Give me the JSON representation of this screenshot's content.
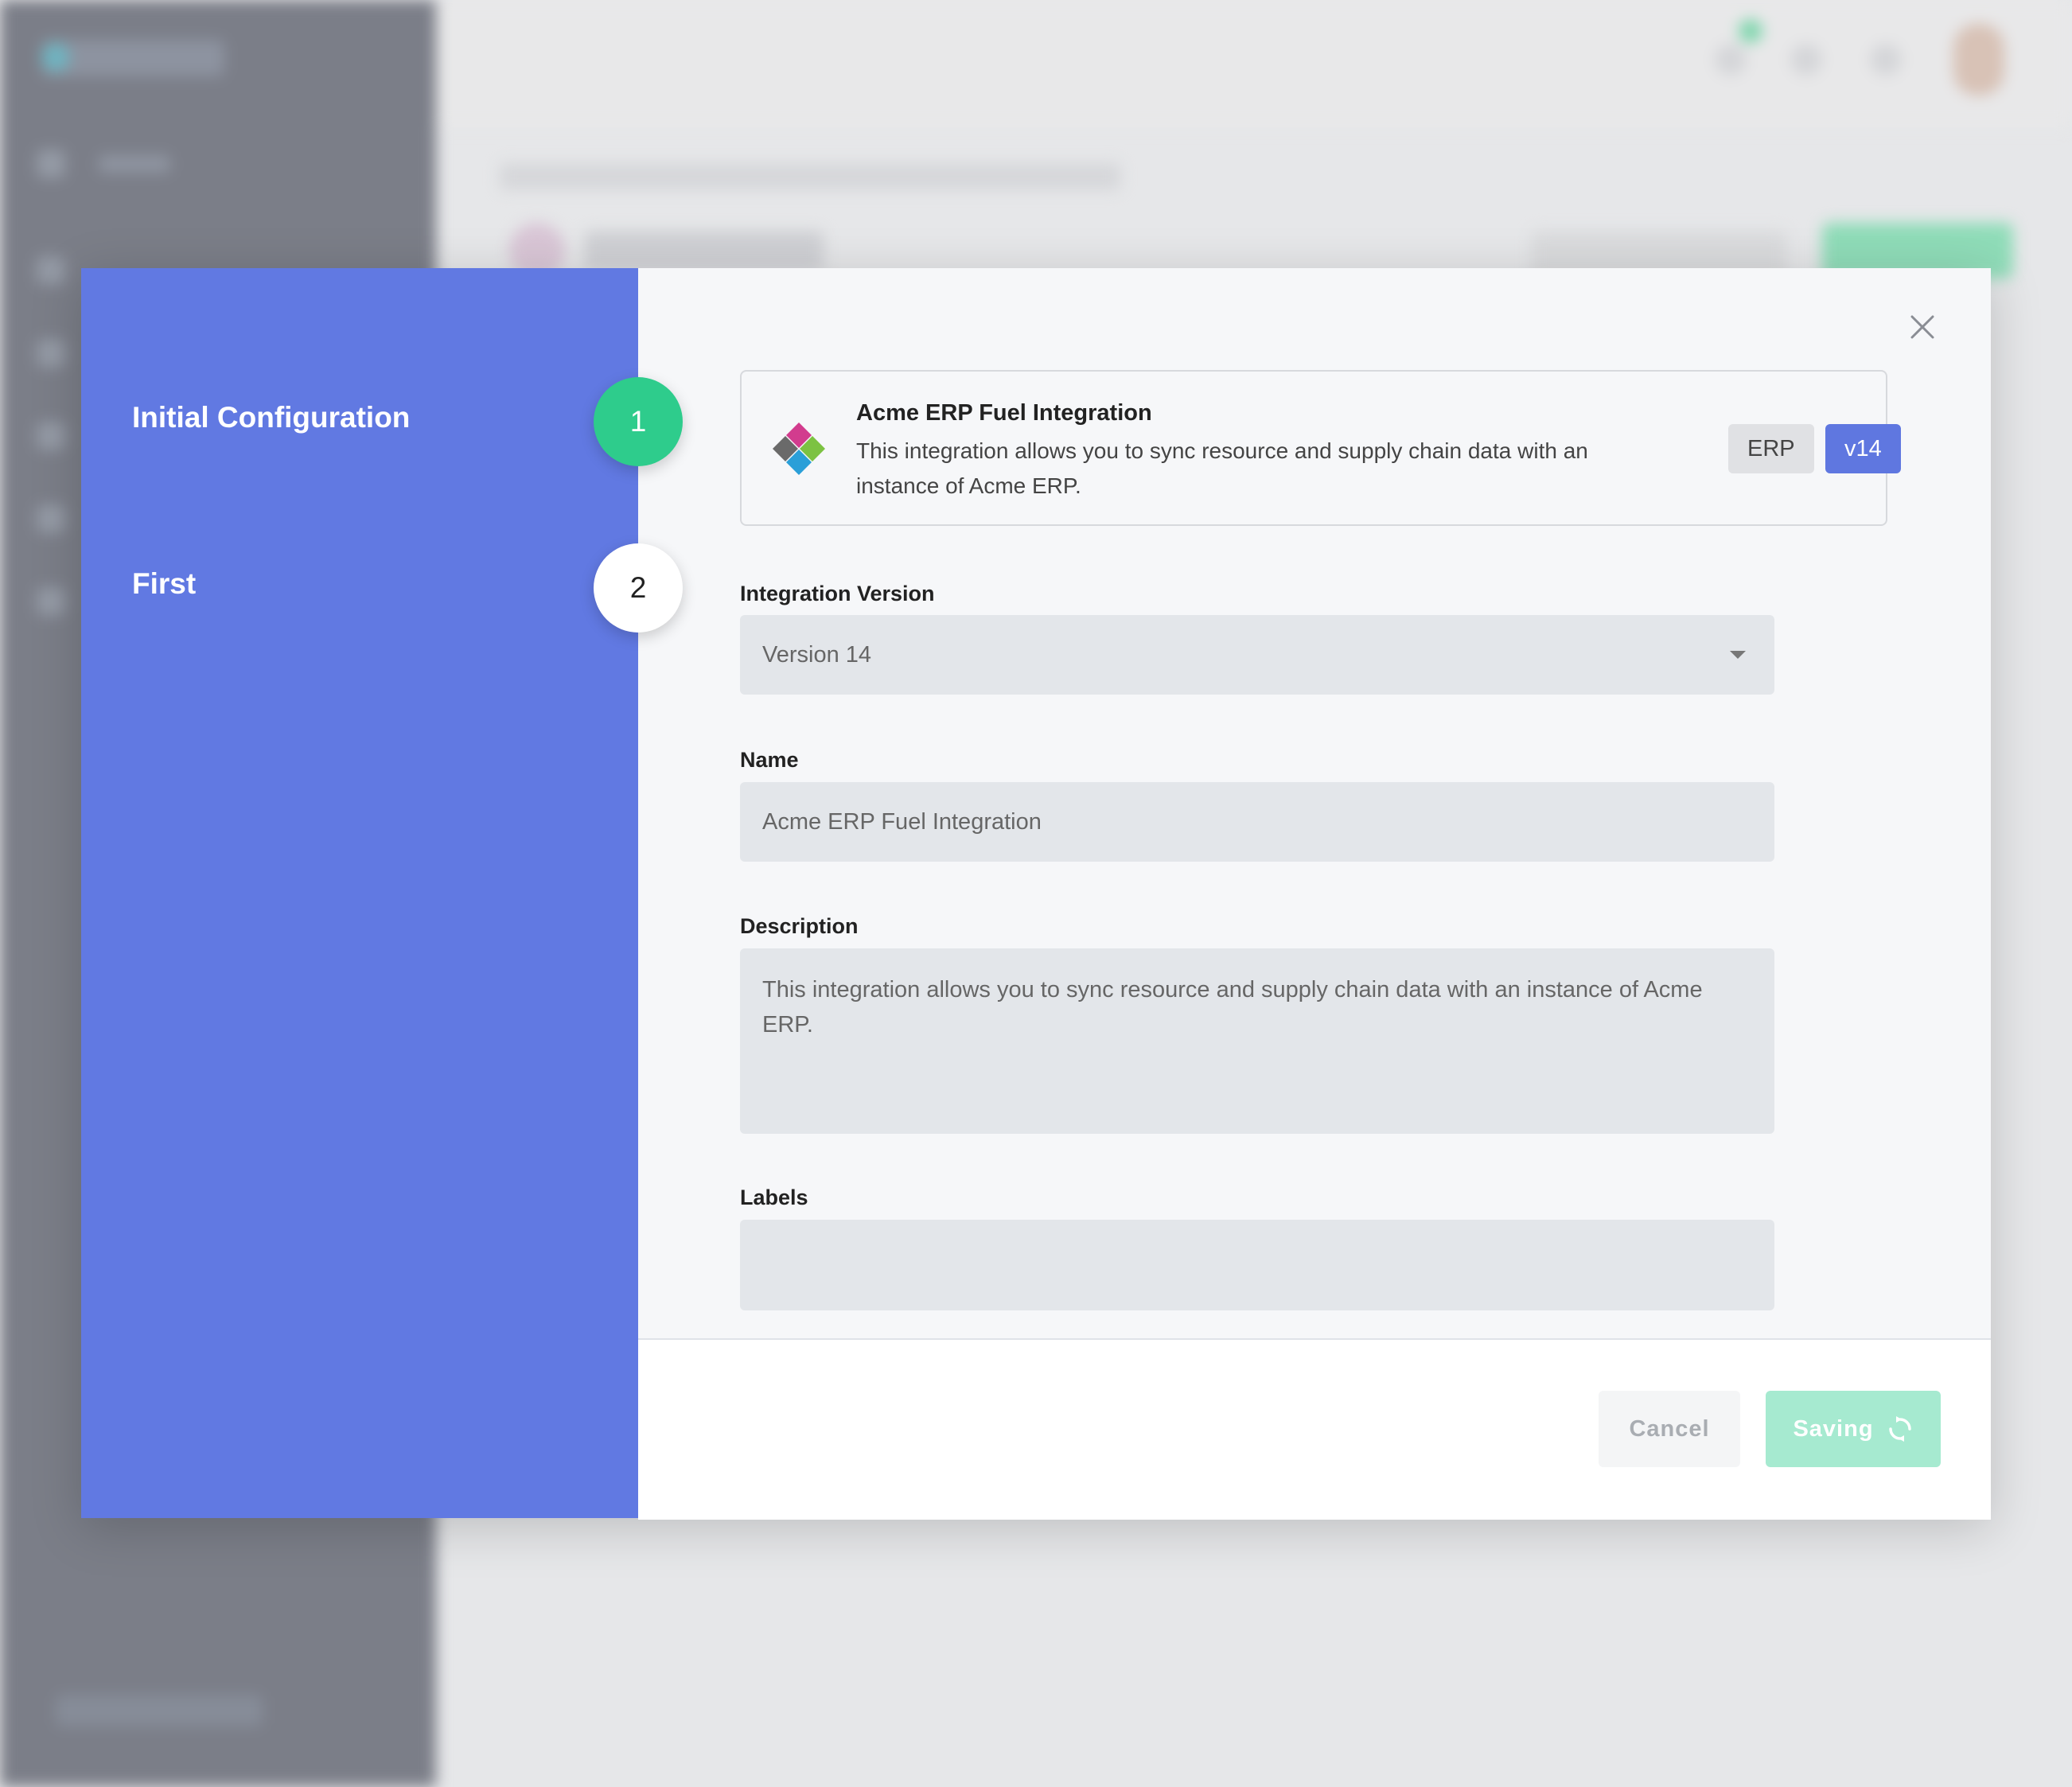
{
  "steps": [
    {
      "label": "Initial Configuration",
      "number": "1",
      "state": "active"
    },
    {
      "label": "First",
      "number": "2",
      "state": "inactive"
    }
  ],
  "card": {
    "title": "Acme ERP Fuel Integration",
    "description": "This integration allows you to sync resource and supply chain data with an instance of Acme ERP.",
    "tags": [
      "ERP",
      "v14"
    ],
    "logo_icon": "diamond-logo-icon"
  },
  "form": {
    "version_label": "Integration Version",
    "version_value": "Version 14",
    "name_label": "Name",
    "name_value": "Acme ERP Fuel Integration",
    "description_label": "Description",
    "description_value": "This integration allows you to sync resource and supply chain data with an instance of Acme ERP.",
    "labels_label": "Labels",
    "labels_value": ""
  },
  "footer": {
    "cancel_label": "Cancel",
    "save_label": "Saving"
  },
  "colors": {
    "sidebar_accent": "#6179e2",
    "active_step": "#2ecc8c",
    "tag_version": "#5f77e0",
    "save_button": "#a6ead0"
  }
}
